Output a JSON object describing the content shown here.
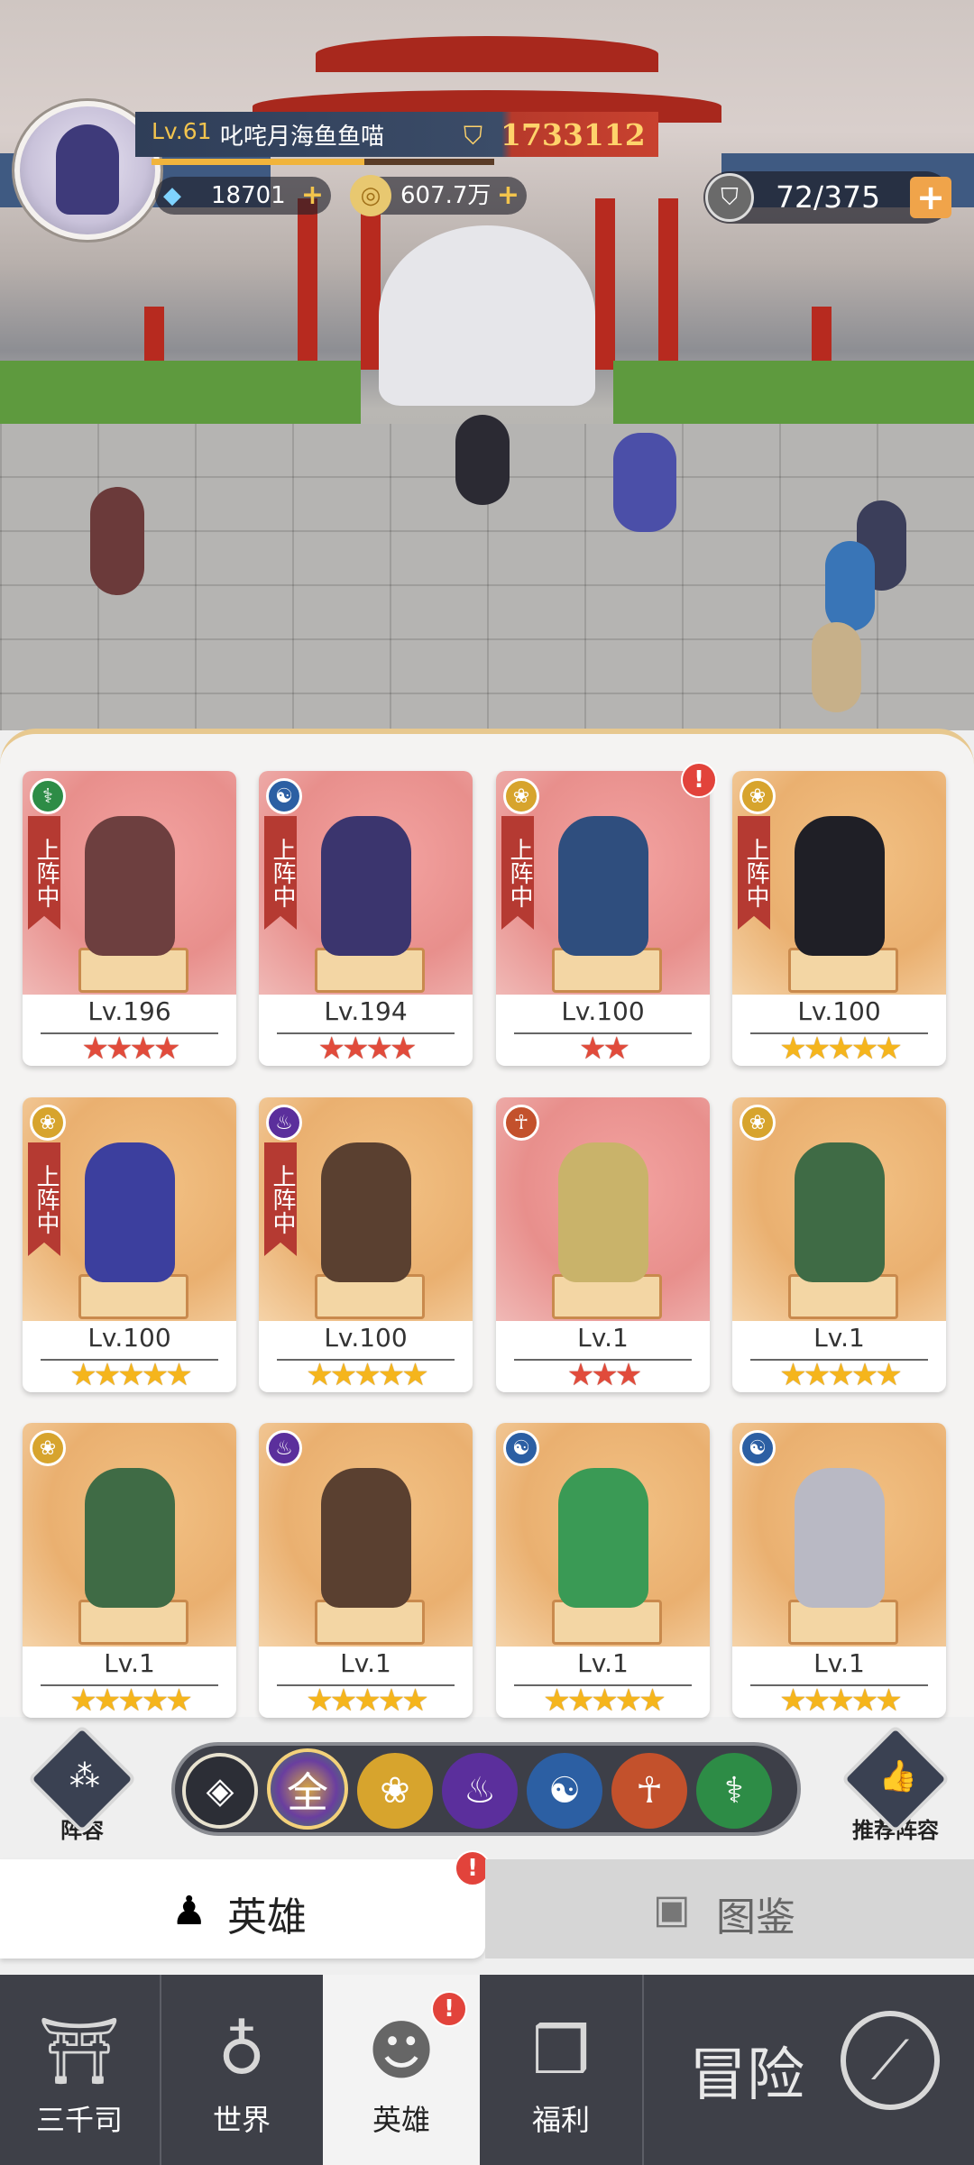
{
  "player": {
    "level": "Lv.61",
    "name": "叱咤月海鱼鱼喵",
    "power": "1733112",
    "xp_fraction": 0.62,
    "diamonds": "18701",
    "gold": "607.7万",
    "stamina": "72/375"
  },
  "heroes": [
    {
      "level": "Lv.196",
      "stars": "★★★★",
      "star_color": "red",
      "bg": "pink",
      "faction_icon": "dna-icon",
      "deployed": true,
      "alert": false
    },
    {
      "level": "Lv.194",
      "stars": "★★★★",
      "star_color": "red",
      "bg": "pink",
      "faction_icon": "water-icon",
      "deployed": true,
      "alert": false
    },
    {
      "level": "Lv.100",
      "stars": "★★",
      "star_color": "red",
      "bg": "pink",
      "faction_icon": "lotus-icon",
      "deployed": true,
      "alert": true
    },
    {
      "level": "Lv.100",
      "stars": "★★★★★",
      "star_color": "gold",
      "bg": "gold",
      "faction_icon": "lotus-icon",
      "deployed": true,
      "alert": false
    },
    {
      "level": "Lv.100",
      "stars": "★★★★★",
      "star_color": "gold",
      "bg": "gold",
      "faction_icon": "lotus-icon",
      "deployed": true,
      "alert": false
    },
    {
      "level": "Lv.100",
      "stars": "★★★★★",
      "star_color": "gold",
      "bg": "gold",
      "faction_icon": "flame-icon",
      "deployed": true,
      "alert": false
    },
    {
      "level": "Lv.1",
      "stars": "★★★",
      "star_color": "red",
      "bg": "pink",
      "faction_icon": "meditate-icon",
      "deployed": false,
      "alert": false
    },
    {
      "level": "Lv.1",
      "stars": "★★★★★",
      "star_color": "gold",
      "bg": "gold",
      "faction_icon": "lotus-icon",
      "deployed": false,
      "alert": false
    },
    {
      "level": "Lv.1",
      "stars": "★★★★★",
      "star_color": "gold",
      "bg": "gold",
      "faction_icon": "lotus-icon",
      "deployed": false,
      "alert": false
    },
    {
      "level": "Lv.1",
      "stars": "★★★★★",
      "star_color": "gold",
      "bg": "gold",
      "faction_icon": "flame-icon",
      "deployed": false,
      "alert": false
    },
    {
      "level": "Lv.1",
      "stars": "★★★★★",
      "star_color": "gold",
      "bg": "gold",
      "faction_icon": "water-icon",
      "deployed": false,
      "alert": false
    },
    {
      "level": "Lv.1",
      "stars": "★★★★★",
      "star_color": "gold",
      "bg": "gold",
      "faction_icon": "water-icon",
      "deployed": false,
      "alert": false
    }
  ],
  "deploy_label": "上阵中",
  "filters": {
    "all_label": "全",
    "icons": [
      "diamond-icon",
      "all-icon",
      "lotus-icon",
      "flame-icon",
      "water-icon",
      "meditate-icon",
      "dna-icon"
    ]
  },
  "buttons": {
    "lineup": "阵容",
    "recommended": "推荐阵容"
  },
  "tabs": {
    "heroes": "英雄",
    "atlas": "图鉴"
  },
  "nav": {
    "sanqiansi": "三千司",
    "world": "世界",
    "heroes": "英雄",
    "welfare": "福利",
    "adventure": "冒险"
  },
  "colors": {
    "accent_gold": "#f5b51c",
    "accent_red": "#e14b3b",
    "nav_bg": "#3e4048"
  }
}
